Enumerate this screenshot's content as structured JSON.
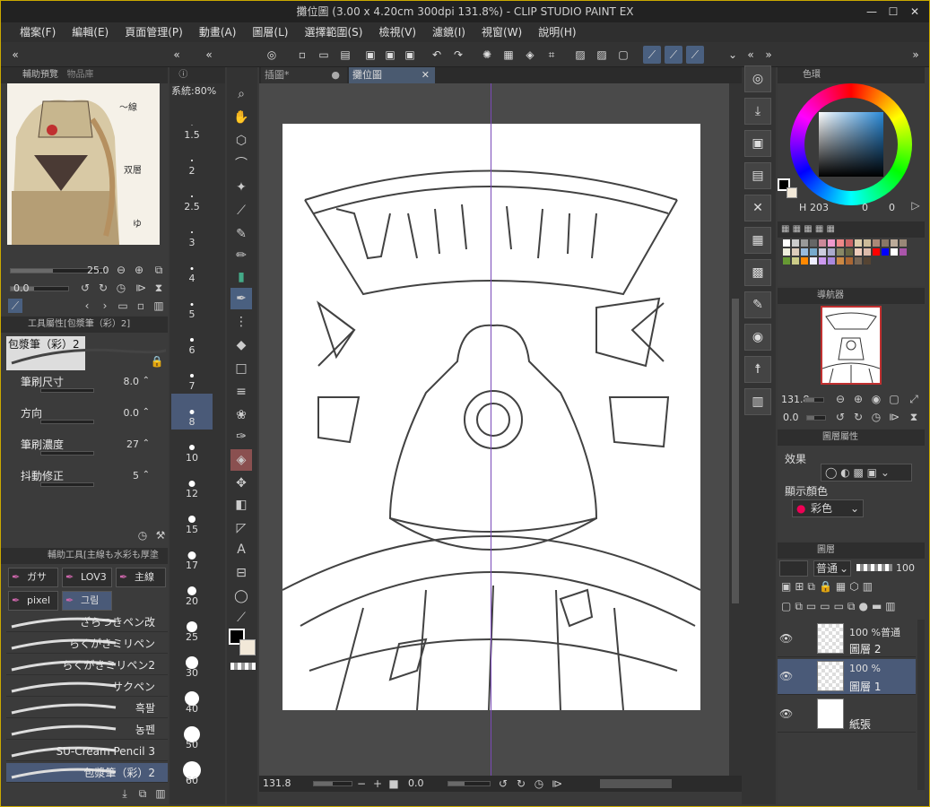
{
  "window": {
    "title": "攤位圖 (3.00 x 4.20cm 300dpi 131.8%) - CLIP STUDIO PAINT EX"
  },
  "menu": [
    "檔案(F)",
    "編輯(E)",
    "頁面管理(P)",
    "動畫(A)",
    "圖層(L)",
    "選擇範圍(S)",
    "檢視(V)",
    "濾鏡(I)",
    "視窗(W)",
    "說明(H)"
  ],
  "left_top": {
    "tab1": "輔助預覽",
    "tab2": "物品庫",
    "size_value": "25.0",
    "rot_value": "0.0"
  },
  "size_panel": {
    "label": "系統:80%",
    "sizes": [
      "1.5",
      "2",
      "2.5",
      "3",
      "4",
      "5",
      "6",
      "7",
      "8",
      "10",
      "12",
      "15",
      "17",
      "20",
      "25",
      "30",
      "40",
      "50",
      "60"
    ],
    "selected": "8"
  },
  "tool_property": {
    "header": "工具屬性[包漿筆（彩）2]",
    "brush_name": "包漿筆（彩）2",
    "rows": [
      {
        "label": "筆刷尺寸",
        "value": "8.0"
      },
      {
        "label": "方向",
        "value": "0.0"
      },
      {
        "label": "筆刷濃度",
        "value": "27"
      },
      {
        "label": "抖動修正",
        "value": "5"
      }
    ]
  },
  "sub_tool": {
    "header": "輔助工具[主線も水彩も厚塗",
    "groups": [
      "ガサ",
      "LOV3",
      "主線",
      "pixel",
      "그림"
    ],
    "brushes": [
      "ざらつきペン改",
      "らくがきミリペン",
      "らくがきミリペン2",
      "サクペン",
      "흑팔",
      "농펜",
      "SU-Cream Pencil 3",
      "包漿筆（彩）2"
    ]
  },
  "canvas": {
    "tab1": "插圖*",
    "tab2": "攤位圖",
    "zoom": "131.8",
    "angle": "0.0"
  },
  "color": {
    "header": "色環",
    "h": "203",
    "s": "0",
    "v": "0"
  },
  "navigator": {
    "header": "導航器",
    "zoom": "131.8",
    "angle": "0.0"
  },
  "layer_property": {
    "header": "圖層屬性",
    "effect": "效果",
    "display_color": "顯示顏色",
    "color_value": "彩色"
  },
  "layers_panel": {
    "header": "圖層",
    "blend": "普通",
    "opacity": "100",
    "layers": [
      {
        "name": "圖層 2",
        "info": "100 %普通"
      },
      {
        "name": "圖層 1",
        "info": "100 %"
      },
      {
        "name": "紙張",
        "info": ""
      }
    ]
  },
  "colors": {
    "accent": "#caa900",
    "selected": "#5a6a8a"
  }
}
